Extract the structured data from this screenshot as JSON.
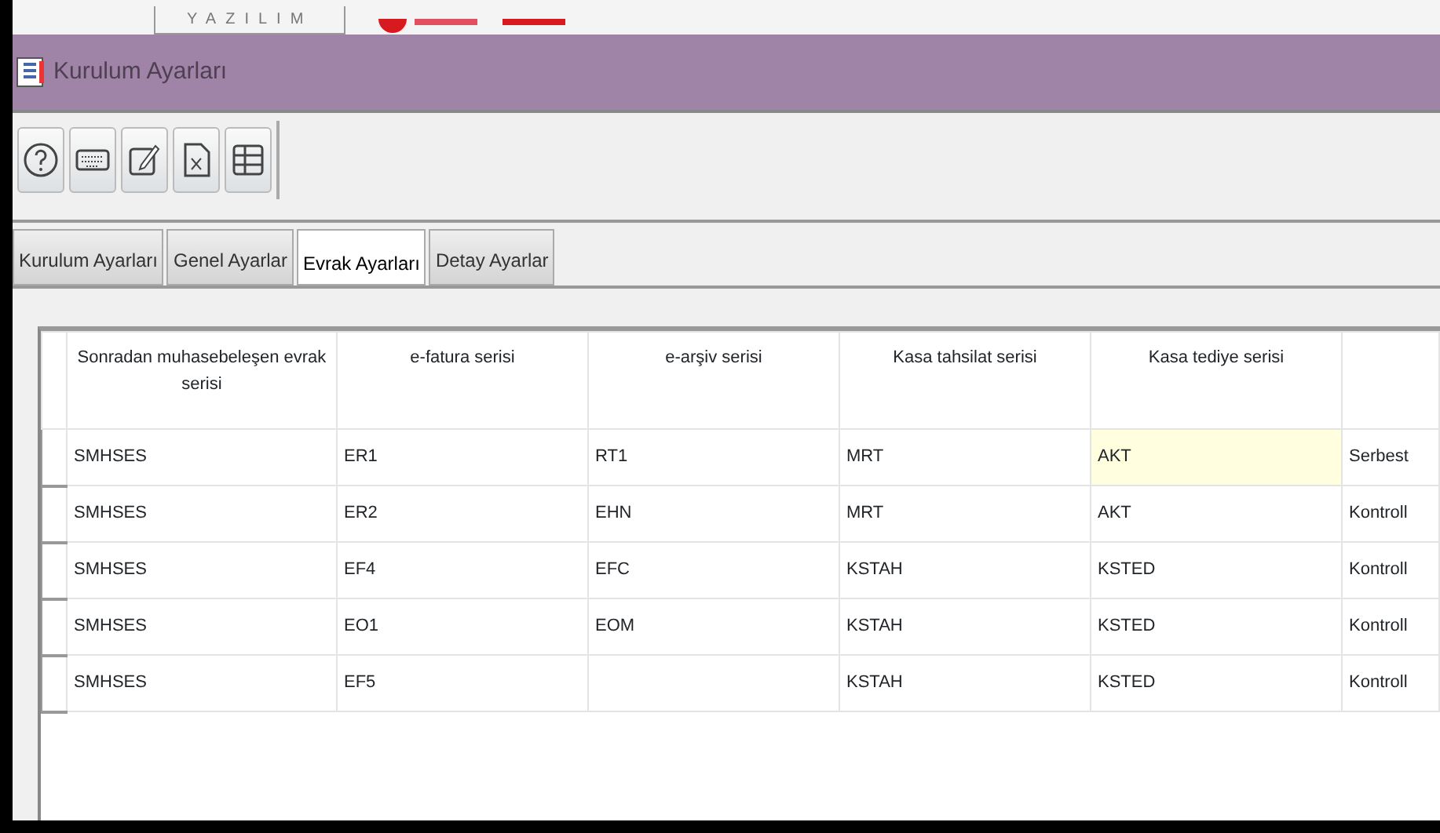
{
  "header": {
    "logo_text": "YAZILIM"
  },
  "window": {
    "title": "Kurulum Ayarları"
  },
  "toolbar": [
    {
      "kind": "help"
    },
    {
      "kind": "keyboard"
    },
    {
      "kind": "edit"
    },
    {
      "kind": "excel"
    },
    {
      "kind": "grid"
    }
  ],
  "tabs": [
    {
      "label": "Kurulum Ayarları",
      "selected": false
    },
    {
      "label": "Genel Ayarlar",
      "selected": false
    },
    {
      "label": "Evrak Ayarları",
      "selected": true
    },
    {
      "label": "Detay Ayarlar",
      "selected": false
    }
  ],
  "table": {
    "columns": [
      "Sonradan muhasebeleşen evrak serisi",
      "e-fatura serisi",
      "e-arşiv serisi",
      "Kasa tahsilat serisi",
      "Kasa tediye serisi"
    ],
    "rows": [
      {
        "cells": [
          {
            "text": "SMHSES",
            "selected": false
          },
          {
            "text": "ER1",
            "selected": false
          },
          {
            "text": "RT1",
            "selected": false
          },
          {
            "text": "MRT",
            "selected": false
          },
          {
            "text": "AKT",
            "selected": true
          },
          {
            "text": "Serbest",
            "selected": false
          }
        ]
      },
      {
        "cells": [
          {
            "text": "SMHSES",
            "selected": false
          },
          {
            "text": "ER2",
            "selected": false
          },
          {
            "text": "EHN",
            "selected": false
          },
          {
            "text": "MRT",
            "selected": false
          },
          {
            "text": "AKT",
            "selected": false
          },
          {
            "text": "Kontroll",
            "selected": false
          }
        ]
      },
      {
        "cells": [
          {
            "text": "SMHSES",
            "selected": false
          },
          {
            "text": "EF4",
            "selected": false
          },
          {
            "text": "EFC",
            "selected": false
          },
          {
            "text": "KSTAH",
            "selected": false
          },
          {
            "text": "KSTED",
            "selected": false
          },
          {
            "text": "Kontroll",
            "selected": false
          }
        ]
      },
      {
        "cells": [
          {
            "text": "SMHSES",
            "selected": false
          },
          {
            "text": "EO1",
            "selected": false
          },
          {
            "text": "EOM",
            "selected": false
          },
          {
            "text": "KSTAH",
            "selected": false
          },
          {
            "text": "KSTED",
            "selected": false
          },
          {
            "text": "Kontroll",
            "selected": false
          }
        ]
      },
      {
        "cells": [
          {
            "text": "SMHSES",
            "selected": false
          },
          {
            "text": "EF5",
            "selected": false
          },
          {
            "text": "",
            "selected": false
          },
          {
            "text": "KSTAH",
            "selected": false
          },
          {
            "text": "KSTED",
            "selected": false
          },
          {
            "text": "Kontroll",
            "selected": false
          }
        ]
      }
    ]
  }
}
